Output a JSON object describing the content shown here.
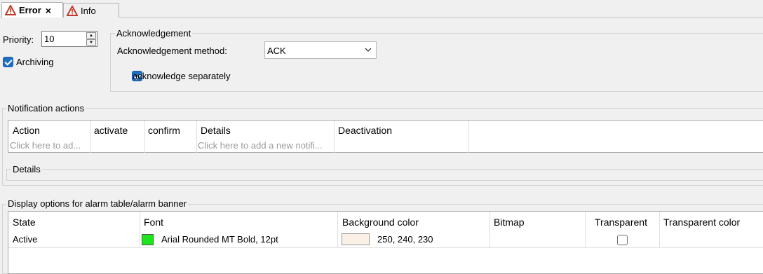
{
  "tabs": [
    {
      "label": "Error",
      "active": true,
      "close": "×",
      "icon": "warning-icon"
    },
    {
      "label": "Info",
      "active": false,
      "icon": "warning-icon"
    }
  ],
  "priority": {
    "label": "Priority:",
    "value": "10"
  },
  "archiving": {
    "label": "Archiving",
    "checked": true
  },
  "acknowledgement": {
    "title": "Acknowledgement",
    "method_label": "Acknowledgement method:",
    "method_value": "ACK",
    "separately_label": "acknowledge separately",
    "separately_checked": true
  },
  "notification": {
    "title": "Notification actions",
    "columns": [
      "Action",
      "activate",
      "confirm",
      "Details",
      "Deactivation"
    ],
    "hint_action": "Click here to ad...",
    "hint_details": "Click here to add a new notifi...",
    "details_title": "Details"
  },
  "display": {
    "title": "Display options for alarm table/alarm banner",
    "columns": [
      "State",
      "Font",
      "Background color",
      "Bitmap",
      "Transparent",
      "Transparent color"
    ],
    "row": {
      "state": "Active",
      "font": "Arial Rounded MT Bold, 12pt",
      "font_color": "#1ee41e",
      "bg_swatch": "#faf0e6",
      "bg_value": "250, 240, 230",
      "transparent": false
    }
  },
  "colors": {
    "accent": "#1f6fc0",
    "warning": "#c0392b"
  }
}
